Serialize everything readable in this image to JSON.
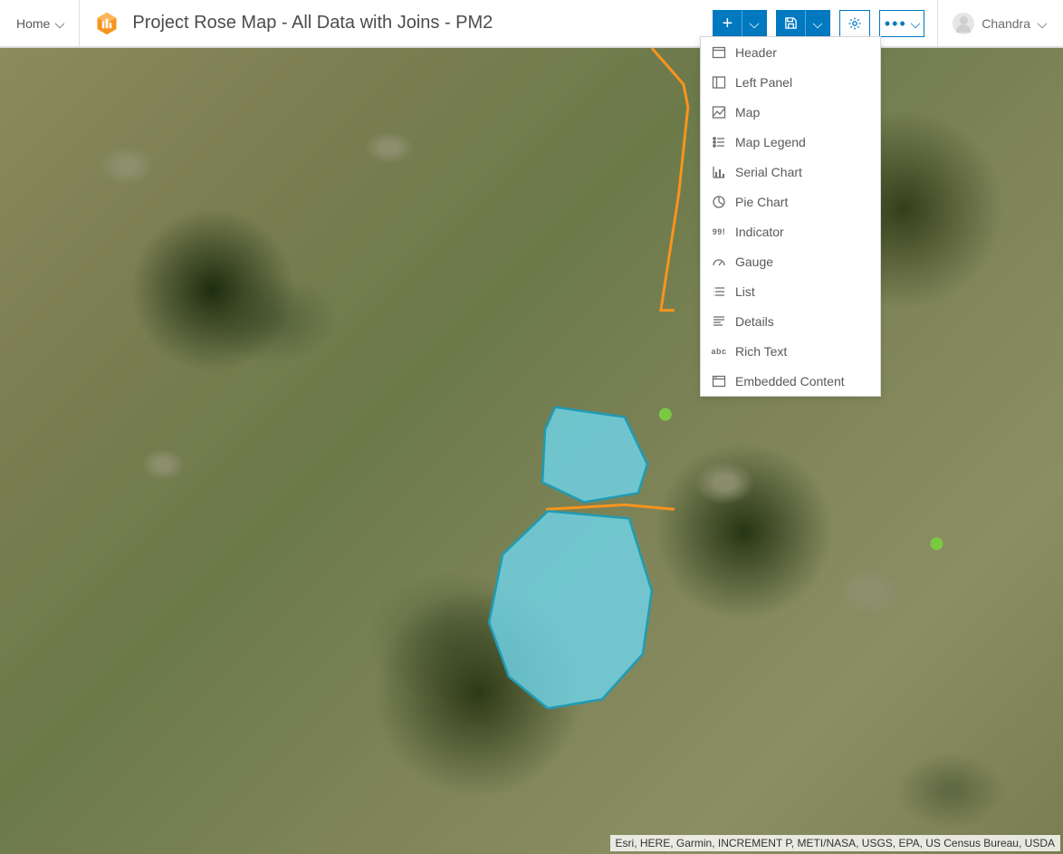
{
  "header": {
    "home_label": "Home",
    "title": "Project Rose Map - All Data with Joins - PM2",
    "user_name": "Chandra"
  },
  "toolbar": {
    "add_label": "+",
    "more_label": "•••"
  },
  "add_menu": {
    "items": [
      {
        "icon": "header",
        "label": "Header"
      },
      {
        "icon": "left-panel",
        "label": "Left Panel"
      },
      {
        "icon": "map",
        "label": "Map"
      },
      {
        "icon": "map-legend",
        "label": "Map Legend"
      },
      {
        "icon": "serial-chart",
        "label": "Serial Chart"
      },
      {
        "icon": "pie-chart",
        "label": "Pie Chart"
      },
      {
        "icon": "indicator",
        "label": "Indicator"
      },
      {
        "icon": "gauge",
        "label": "Gauge"
      },
      {
        "icon": "list",
        "label": "List"
      },
      {
        "icon": "details",
        "label": "Details"
      },
      {
        "icon": "rich-text",
        "label": "Rich Text"
      },
      {
        "icon": "embedded-content",
        "label": "Embedded Content"
      }
    ]
  },
  "map": {
    "attribution": "Esri, HERE, Garmin, INCREMENT P, METI/NASA, USGS, EPA, US Census Bureau, USDA",
    "overlay": {
      "polygon_fill": "#6fd3e8",
      "polygon_stroke": "#1f9bb5",
      "line_color": "#f7941d",
      "point_color": "#7ac943"
    }
  }
}
